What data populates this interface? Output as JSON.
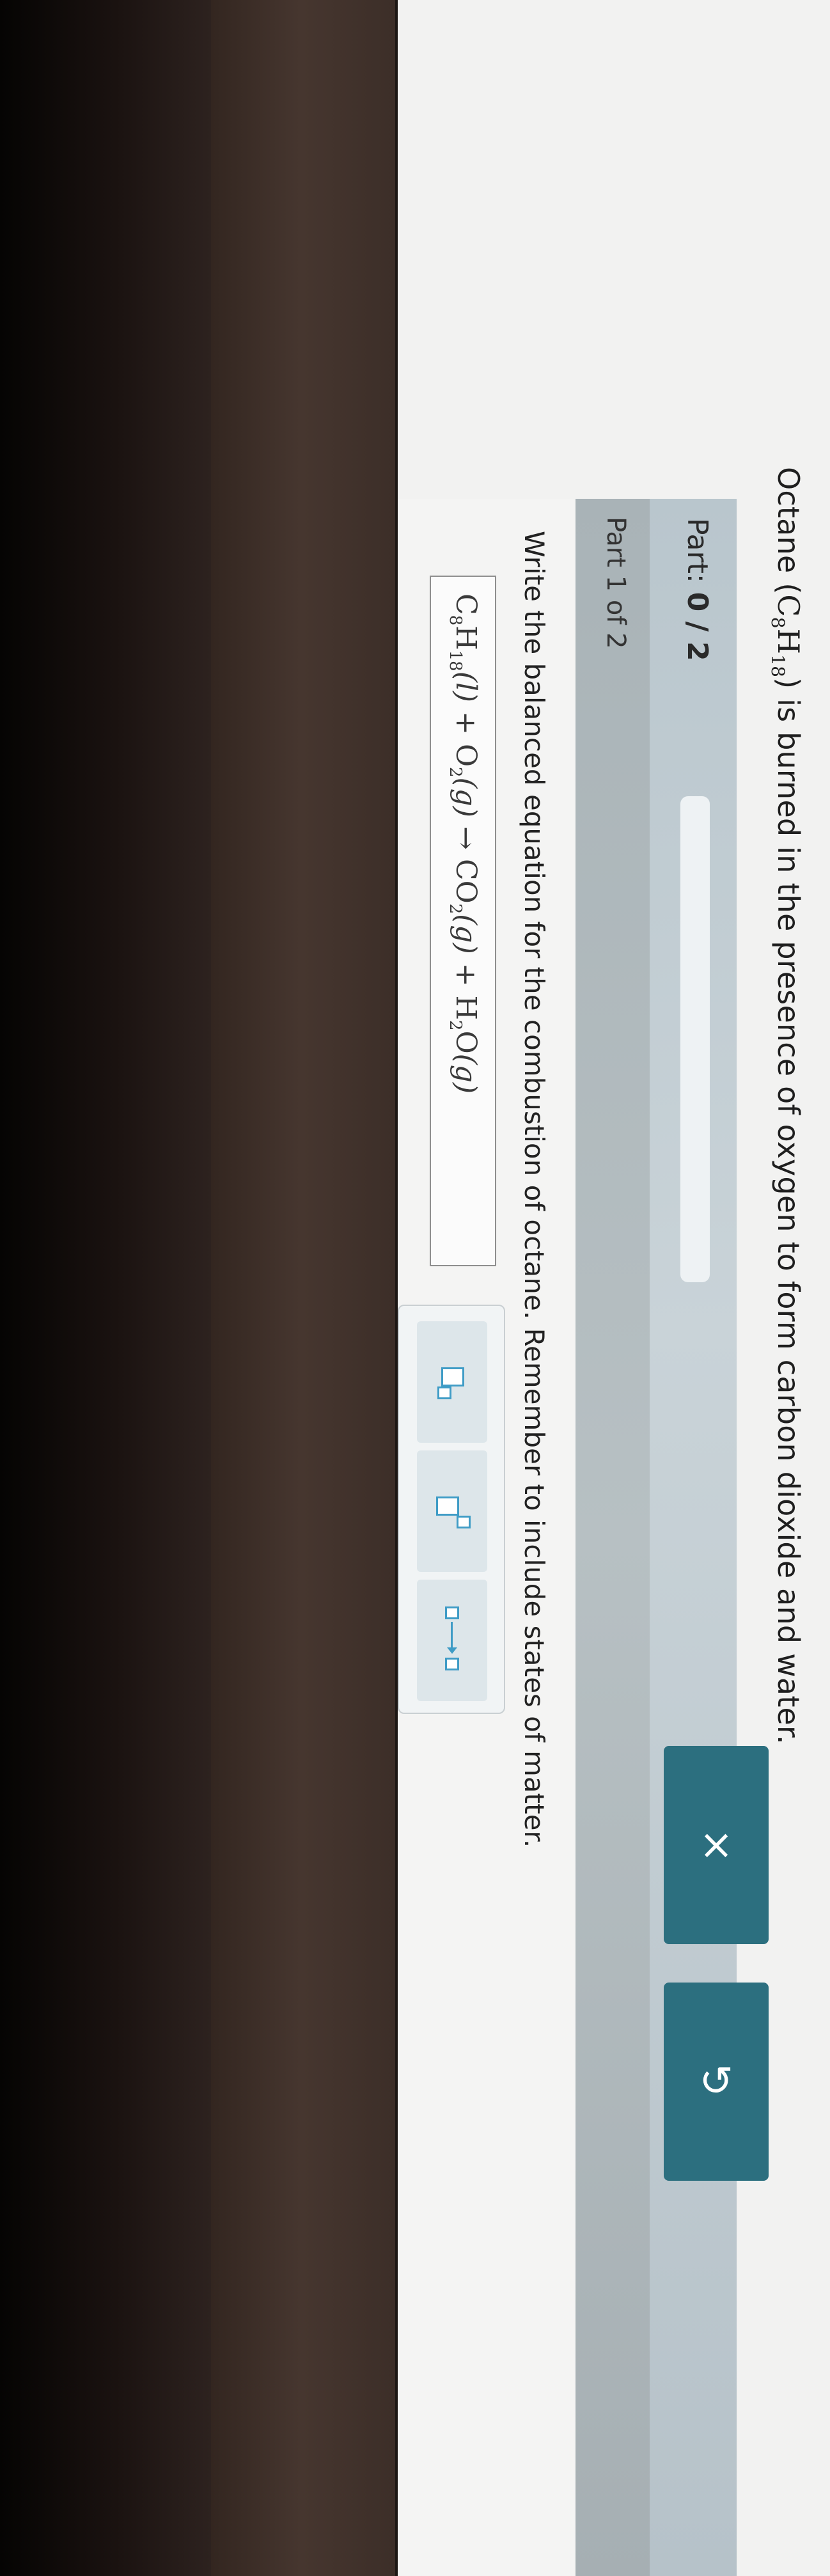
{
  "question": {
    "prefix": "Octane (",
    "formula": {
      "c": "C",
      "c_sub": "8",
      "h": "H",
      "h_sub": "18"
    },
    "suffix": ") is burned in the presence of oxygen to form carbon dioxide and water."
  },
  "part_header": {
    "label": "Part: ",
    "score": "0 / 2",
    "progress_fraction": 0
  },
  "sub_header": {
    "label": "Part 1 of 2"
  },
  "instruction": "Write the balanced equation for the combustion of octane. Remember to include states of matter.",
  "equation": {
    "octane_c": "C",
    "octane_c_sub": "8",
    "octane_h": "H",
    "octane_h_sub": "18",
    "octane_state": "(l)",
    "plus1": "+",
    "o2": "O",
    "o2_sub": "2",
    "o2_state": "(g)",
    "arrow": "→",
    "co2": "CO",
    "co2_sub": "2",
    "co2_state": "(g)",
    "plus2": "+",
    "h2o_h": "H",
    "h2o_sub": "2",
    "h2o_o": "O",
    "h2o_state": "(g)"
  },
  "toolbox": {
    "tools": [
      {
        "name": "subscript-tool",
        "icon": "subscript-box-icon"
      },
      {
        "name": "superscript-tool",
        "icon": "superscript-box-icon"
      },
      {
        "name": "reaction-arrow-tool",
        "icon": "reaction-arrow-icon"
      }
    ],
    "clear_button": {
      "icon": "close-x-icon",
      "glyph": "×"
    },
    "undo_button": {
      "icon": "undo-icon",
      "glyph": "↺"
    }
  },
  "colors": {
    "accent": "#2c6f7f",
    "tool_icon": "#3f9cc6",
    "part_bar": "#c4ced4",
    "sub_bar": "#b0babd"
  }
}
